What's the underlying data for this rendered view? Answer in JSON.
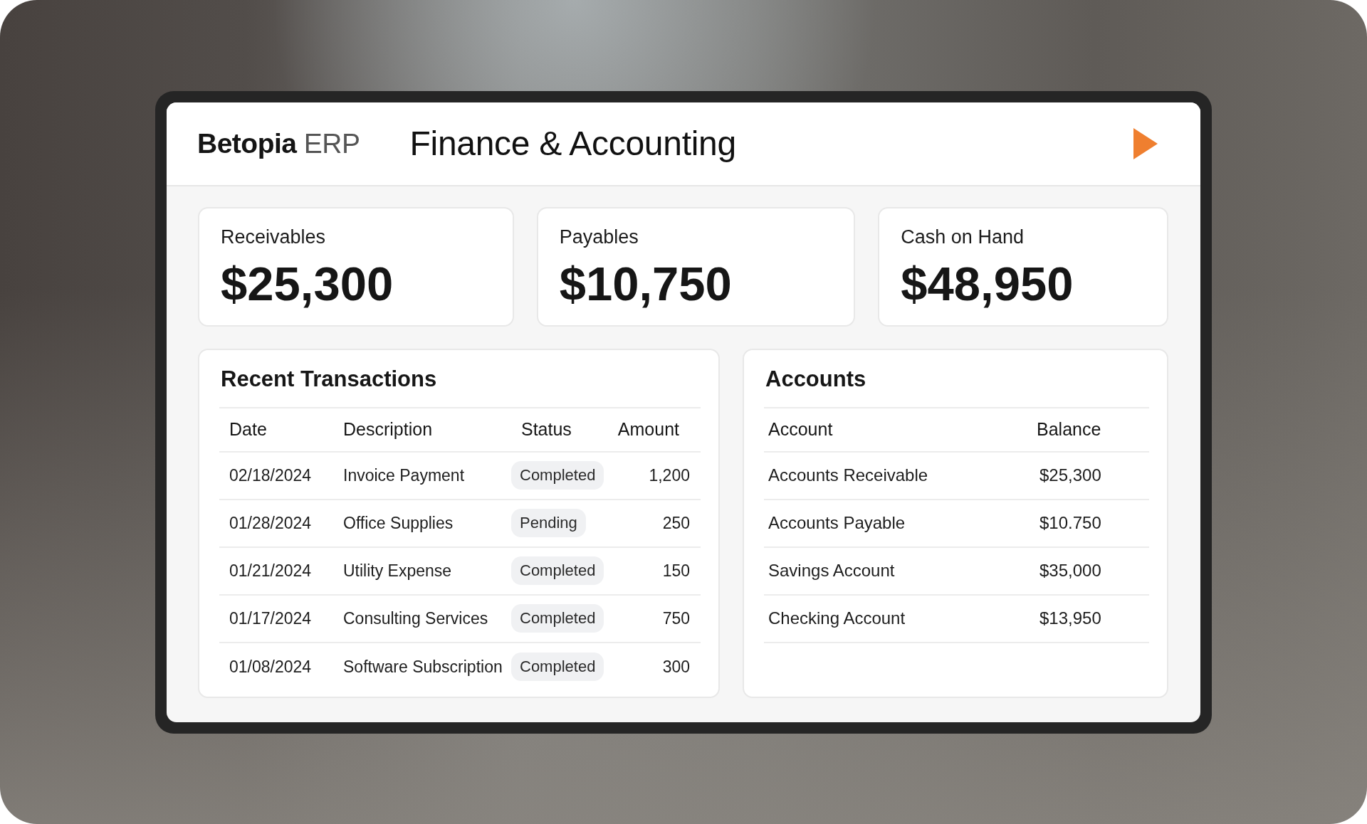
{
  "header": {
    "brand": "**Betopia** ERP",
    "title": "Finance & Accounting"
  },
  "summary_cards": [
    {
      "label": "Receivables",
      "value": "$25,300"
    },
    {
      "label": "Payables",
      "value": "$10,750"
    },
    {
      "label": "Cash on Hand",
      "value": "$48,950"
    }
  ],
  "transactions": {
    "title": "Recent Transactions",
    "columns": [
      "Date",
      "Description",
      "Status",
      "Amount"
    ],
    "rows": [
      {
        "date": "02/18/2024",
        "description": "Invoice Payment",
        "status": "Completed",
        "amount": "1,200"
      },
      {
        "date": "01/28/2024",
        "description": "Office Supplies",
        "status": "Pending",
        "amount": "250"
      },
      {
        "date": "01/21/2024",
        "description": "Utility Expense",
        "status": "Completed",
        "amount": "150"
      },
      {
        "date": "01/17/2024",
        "description": "Consulting Services",
        "status": "Completed",
        "amount": "750"
      },
      {
        "date": "01/08/2024",
        "description": "Software Subscription",
        "status": "Completed",
        "amount": "300"
      }
    ]
  },
  "accounts": {
    "title": "Accounts",
    "columns": [
      "Account",
      "Balance"
    ],
    "rows": [
      {
        "account": "Accounts Receivable",
        "balance": "$25,300"
      },
      {
        "account": "Accounts Payable",
        "balance": "$10.750"
      },
      {
        "account": "Savings Account",
        "balance": "$35,000"
      },
      {
        "account": "Checking Account",
        "balance": "$13,950"
      }
    ]
  }
}
